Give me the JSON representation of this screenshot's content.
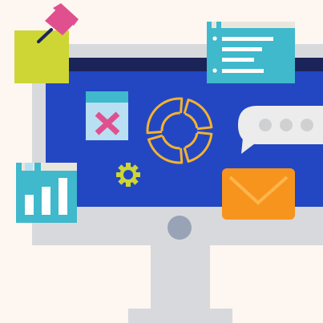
{
  "colors": {
    "background": "#fef6f0",
    "monitor_frame": "#d7d9dc",
    "monitor_stand": "#d7d9dc",
    "screen": "#2347c2",
    "screen_top_bar": "#1b2458",
    "power_button": "#98a3b6",
    "sticky_note": "#cdd635",
    "pushpin": "#e0508f",
    "pushpin_needle": "#1b2458",
    "list_window": "#3fb9cb",
    "list_window_header": "#e9e6de",
    "list_lines": "#ffffff",
    "chart_window": "#3fb9cb",
    "chart_window_header": "#e9e6de",
    "chart_bars": "#ffffff",
    "close_window": "#b9dff3",
    "close_window_header": "#3fb9cb",
    "close_mark": "#e0508f",
    "ring": "#f4b22e",
    "gear": "#cdd635",
    "speech_bubble": "#ececec",
    "speech_dots": "#cfd0d2",
    "envelope": "#f7941d",
    "envelope_flap": "#fdb64d"
  },
  "icons": [
    "monitor-icon",
    "sticky-note-icon",
    "pushpin-icon",
    "list-window-icon",
    "close-window-icon",
    "loading-ring-icon",
    "gear-icon",
    "speech-bubble-icon",
    "envelope-icon",
    "bar-chart-window-icon"
  ],
  "chart_window": {
    "bar_levels": [
      0.55,
      0.75,
      1.0
    ]
  }
}
